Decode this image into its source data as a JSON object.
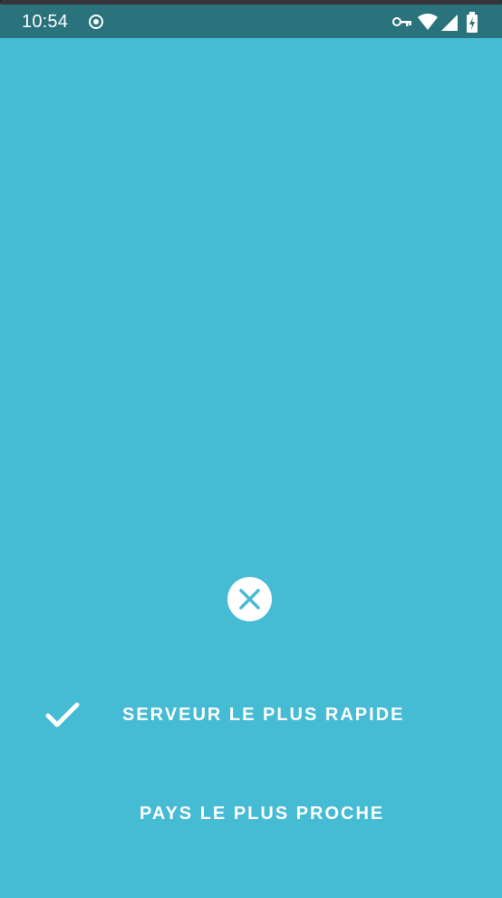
{
  "status_bar": {
    "time": "10:54",
    "icons": [
      "record-icon",
      "vpn-key-icon",
      "wifi-icon",
      "cell-signal-icon",
      "battery-charging-icon"
    ]
  },
  "dialog": {
    "close_icon": "close-icon",
    "options": [
      {
        "label": "SERVEUR LE PLUS RAPIDE",
        "selected": true,
        "icon": "check-icon"
      },
      {
        "label": "PAYS LE PLUS PROCHE",
        "selected": false
      }
    ]
  },
  "colors": {
    "background": "#45bbd4",
    "status_bar": "#2a737d",
    "close_icon_color": "#45bbd4",
    "text": "#ffffff"
  }
}
